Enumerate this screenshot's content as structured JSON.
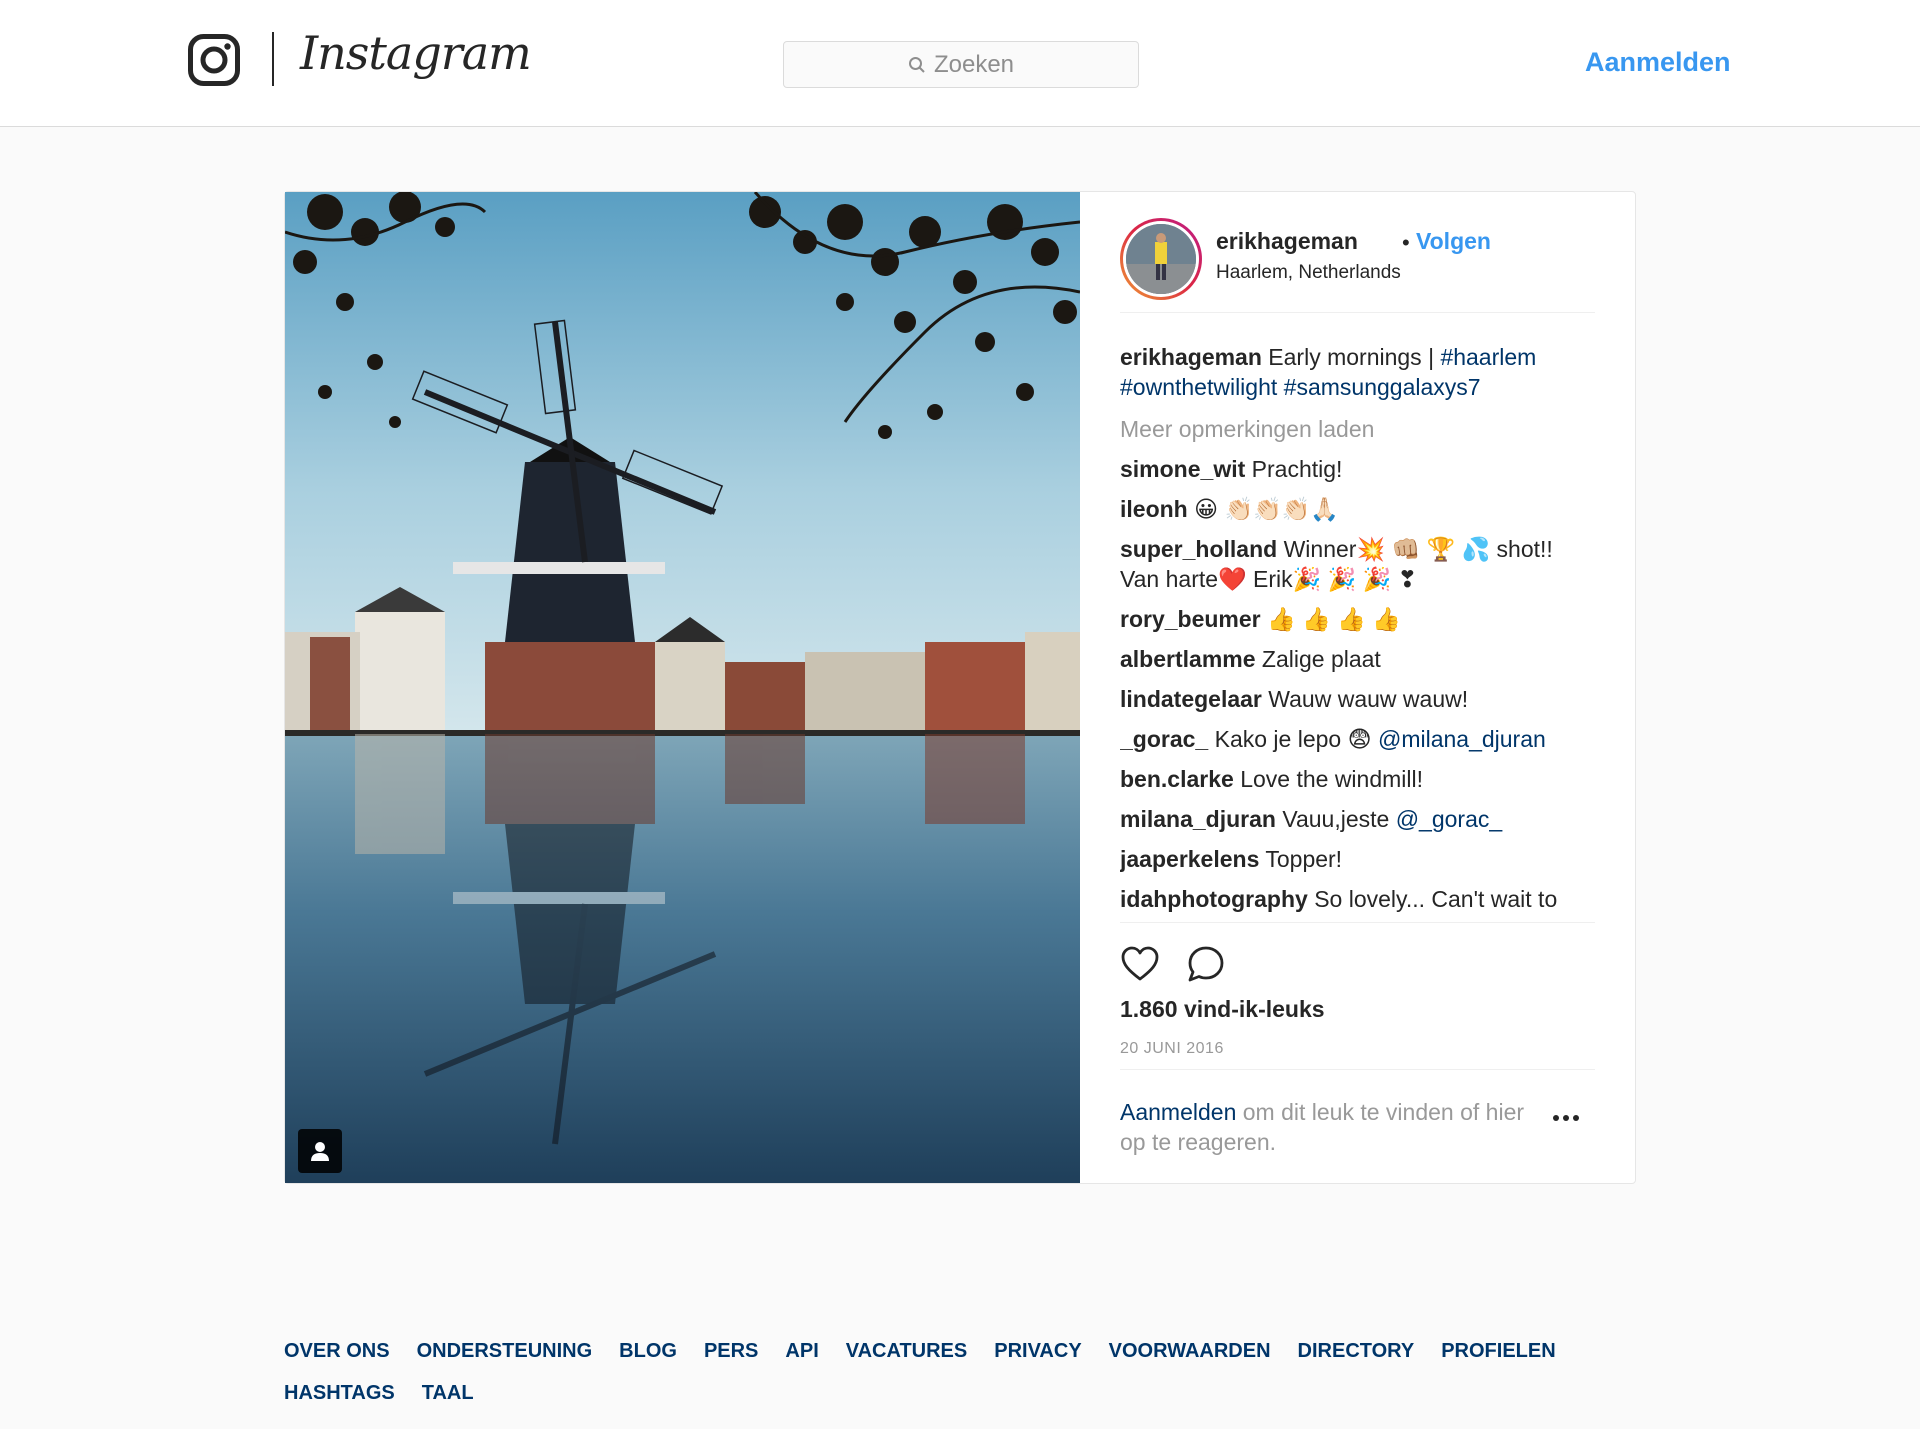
{
  "header": {
    "logo_icon": "instagram-camera-icon",
    "wordmark": "Instagram",
    "search_placeholder": "Zoeken",
    "login": "Aanmelden"
  },
  "post": {
    "username": "erikhageman",
    "separator": "•",
    "follow": "Volgen",
    "location": "Haarlem, Netherlands",
    "caption": {
      "user": "erikhageman",
      "text": "Early mornings | ",
      "tags": [
        "#haarlem",
        "#ownthetwilight",
        "#samsunggalaxys7"
      ]
    },
    "load_more": "Meer opmerkingen laden",
    "comments": [
      {
        "user": "simone_wit",
        "text": "Prachtig!"
      },
      {
        "user": "ileonh",
        "text": "😀 👏🏻👏🏻👏🏻🙏🏻"
      },
      {
        "user": "super_holland",
        "text": "Winner💥 👊🏼 🏆 💦 shot!! Van harte❤️ Erik🎉 🎉 🎉 ❣"
      },
      {
        "user": "rory_beumer",
        "text": "👍 👍 👍 👍"
      },
      {
        "user": "albertlamme",
        "text": "Zalige plaat"
      },
      {
        "user": "lindategelaar",
        "text": "Wauw wauw wauw!"
      },
      {
        "user": "_gorac_",
        "text": "Kako je lepo 😨 ",
        "mention": "@milana_djuran"
      },
      {
        "user": "ben.clarke",
        "text": "Love the windmill!"
      },
      {
        "user": "milana_djuran",
        "text": "Vauu,jeste ",
        "mention": "@_gorac_"
      },
      {
        "user": "jaaperkelens",
        "text": "Topper!"
      },
      {
        "user": "idahphotography",
        "text": "So lovely... Can't wait to visit the Netherlands soon! :) Had..."
      }
    ],
    "likes": "1.860 vind-ik-leuks",
    "date": "20 JUNI 2016",
    "signin_link": "Aanmelden",
    "signin_text": " om dit leuk te vinden of hier op te reageren.",
    "icons": {
      "like": "heart-icon",
      "comment": "comment-bubble-icon",
      "more": "more-options-icon",
      "tagged": "tagged-user-icon"
    }
  },
  "footer": {
    "row1": [
      "OVER ONS",
      "ONDERSTEUNING",
      "BLOG",
      "PERS",
      "API",
      "VACATURES",
      "PRIVACY",
      "VOORWAARDEN",
      "DIRECTORY",
      "PROFIELEN"
    ],
    "row2": [
      "HASHTAGS",
      "TAAL"
    ]
  }
}
